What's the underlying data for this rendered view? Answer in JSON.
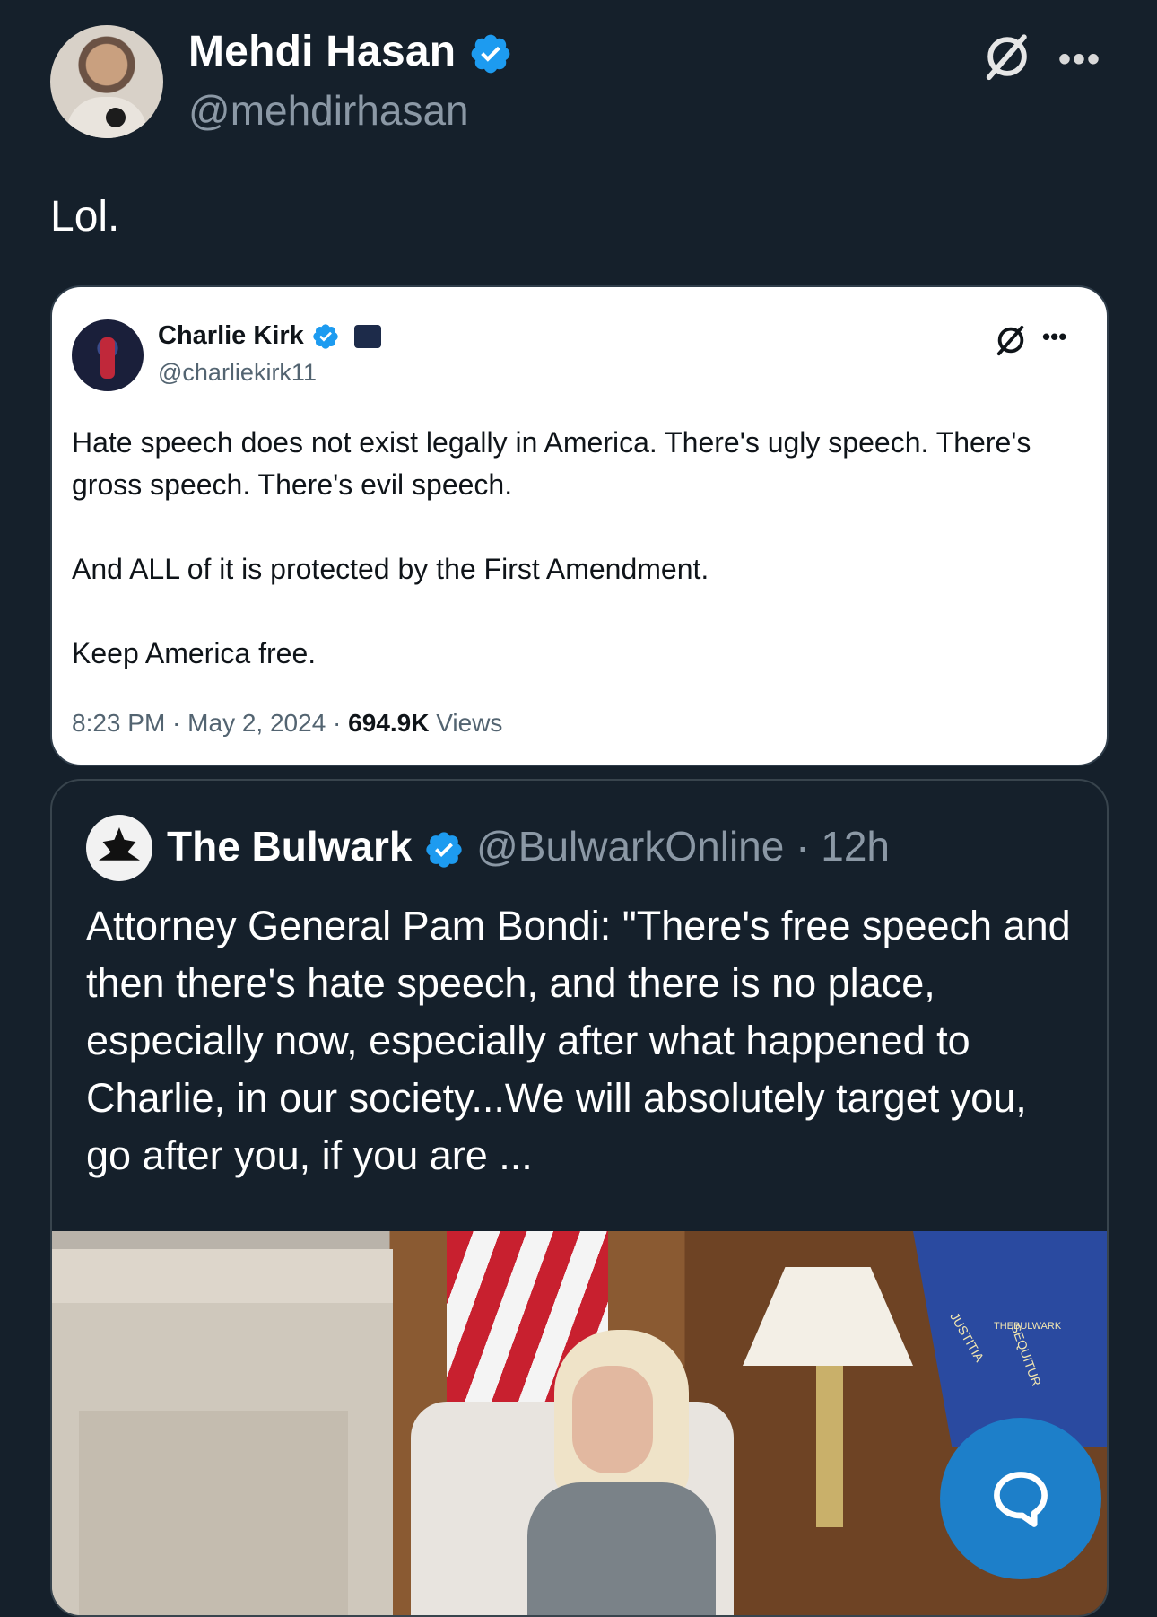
{
  "post": {
    "author_name": "Mehdi Hasan",
    "author_handle": "@mehdirhasan",
    "text": "Lol."
  },
  "screenshot_card": {
    "author_name": "Charlie Kirk",
    "author_handle": "@charliekirk11",
    "paragraphs": [
      "Hate speech does not exist legally in America. There's ugly speech. There's gross speech. There's evil speech.",
      "And ALL of it is protected by the First Amendment.",
      "Keep America free."
    ],
    "time": "8:23 PM",
    "date": "May 2, 2024",
    "views_count": "694.9K",
    "views_label": "Views"
  },
  "quoted_tweet": {
    "author_name": "The Bulwark",
    "author_handle": "@BulwarkOnline",
    "age": "12h",
    "text": "Attorney General Pam Bondi: \"There's free speech and then there's hate speech, and there is no place, especially now, especially after what happened to Charlie, in our society...We will absolutely target you, go after you, if you are ..."
  },
  "media": {
    "seal_text_left": "JUSTITIA",
    "seal_text_right": "SEQUITUR",
    "watermark": "THEBULWARK"
  },
  "icons": {
    "verified": "verified-badge-icon",
    "grok": "grok-icon",
    "more": "more-icon",
    "compose": "chat-bubble-icon"
  },
  "colors": {
    "background": "#15202b",
    "accent": "#1d9bf0",
    "muted": "#8b98a5",
    "fab": "#1d7fc9"
  }
}
